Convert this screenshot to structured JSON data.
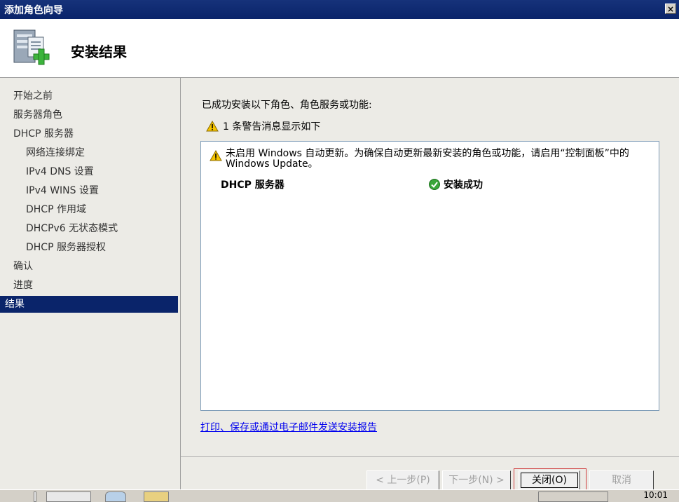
{
  "window": {
    "title": "添加角色向导",
    "close_glyph": "×"
  },
  "header": {
    "heading": "安装结果",
    "icon": "server-add-role-icon"
  },
  "sidebar": {
    "items": [
      {
        "label": "开始之前"
      },
      {
        "label": "服务器角色"
      },
      {
        "label": "DHCP 服务器"
      },
      {
        "label": "网络连接绑定"
      },
      {
        "label": "IPv4 DNS 设置"
      },
      {
        "label": "IPv4 WINS 设置"
      },
      {
        "label": "DHCP 作用域"
      },
      {
        "label": "DHCPv6 无状态模式"
      },
      {
        "label": "DHCP 服务器授权"
      },
      {
        "label": "确认"
      },
      {
        "label": "进度"
      },
      {
        "label": "结果"
      }
    ]
  },
  "main": {
    "intro": "已成功安装以下角色、角色服务或功能:",
    "warning_summary": "1 条警告消息显示如下",
    "warning_message": "未启用 Windows 自动更新。为确保自动更新最新安装的角色或功能，请启用“控制面板”中的 Windows Update。",
    "result": {
      "role": "DHCP 服务器",
      "status": "安装成功"
    },
    "report_link": "打印、保存或通过电子邮件发送安装报告"
  },
  "footer": {
    "prev_label": "< 上一步(P)",
    "next_label": "下一步(N) >",
    "close_label": "关闭(O)",
    "cancel_label": "取消"
  },
  "taskbar": {
    "clock": "10:01"
  },
  "colors": {
    "titlebar": "#0a246a",
    "active_nav": "#0a246a",
    "link": "#0000ee",
    "warning": "#f5c400",
    "success": "#3aa63a"
  }
}
